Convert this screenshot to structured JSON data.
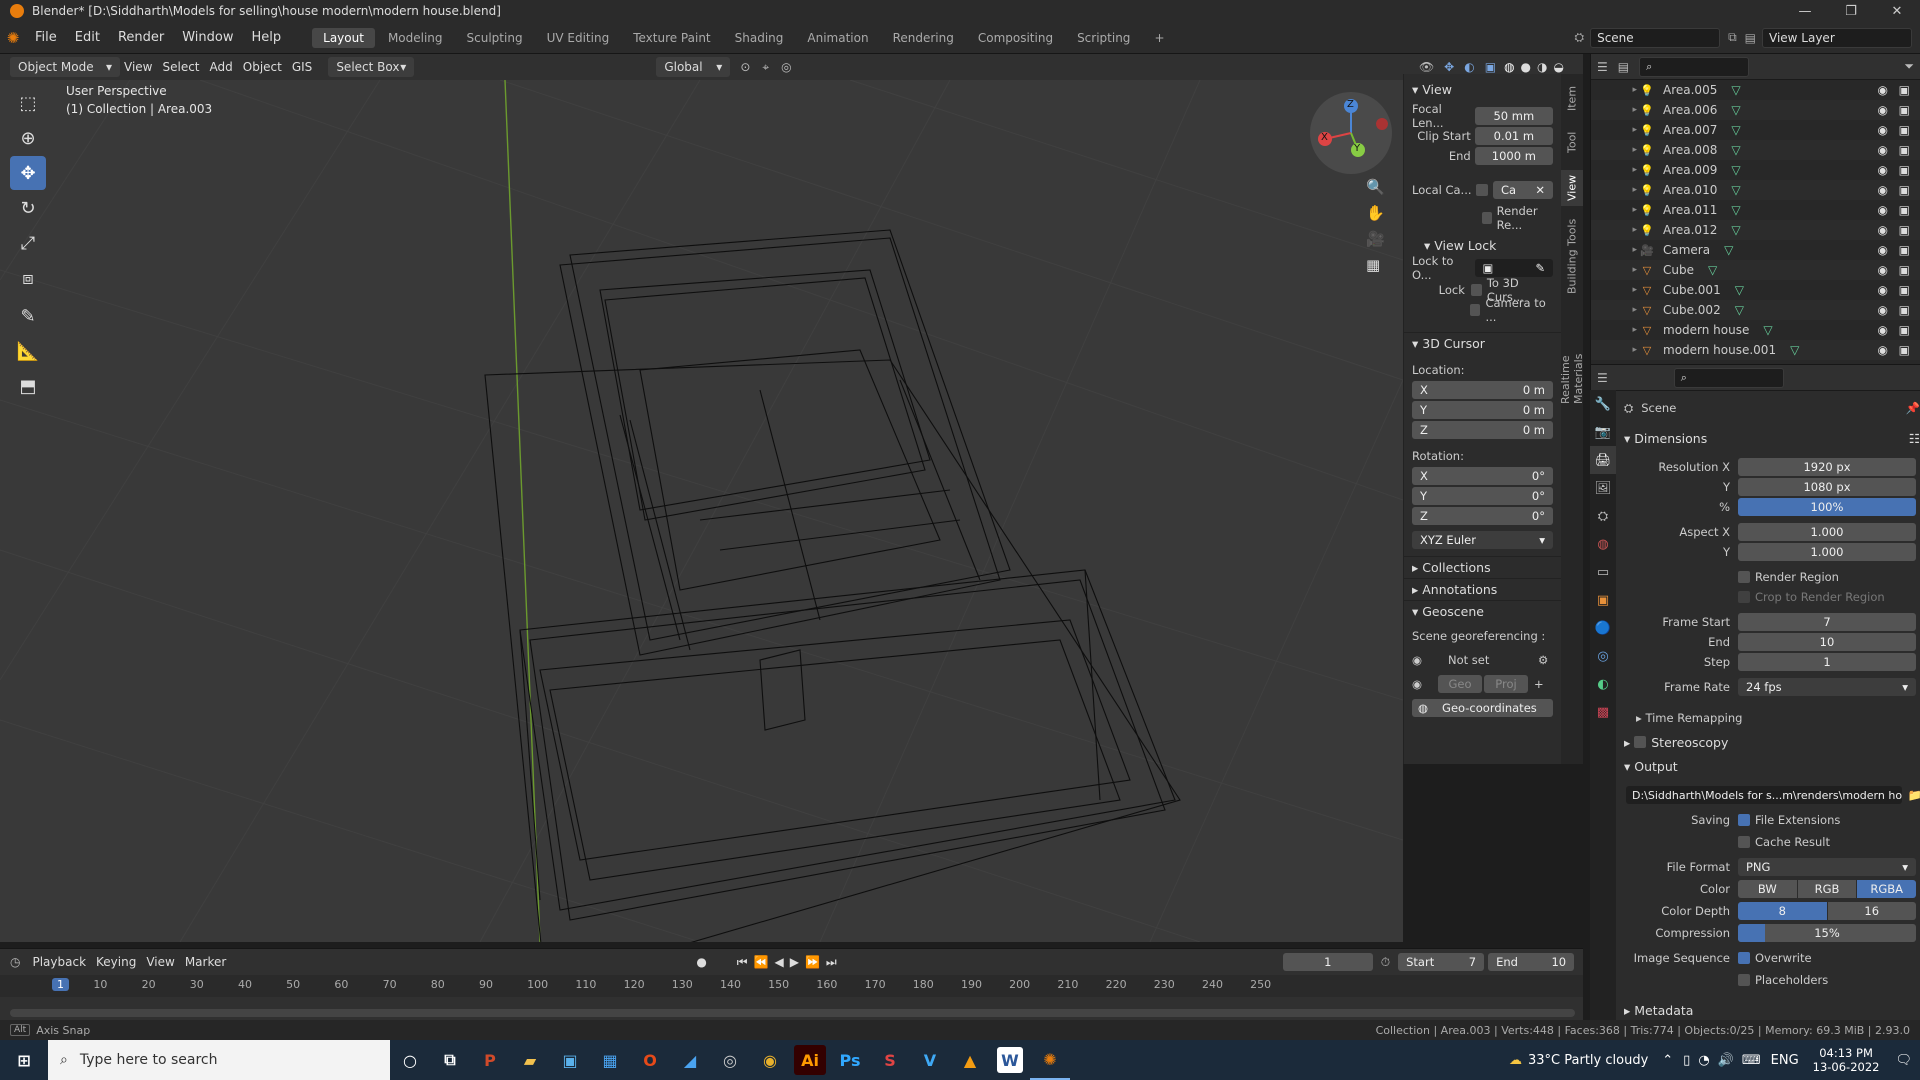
{
  "titlebar": {
    "title": "Blender* [D:\\Siddharth\\Models for selling\\house modern\\modern house.blend]"
  },
  "menubar": {
    "menus": [
      "File",
      "Edit",
      "Render",
      "Window",
      "Help"
    ],
    "workspaces": [
      "Layout",
      "Modeling",
      "Sculpting",
      "UV Editing",
      "Texture Paint",
      "Shading",
      "Animation",
      "Rendering",
      "Compositing",
      "Scripting"
    ],
    "add_tab": "+",
    "scene": "Scene",
    "view_layer": "View Layer"
  },
  "viewport_header": {
    "mode": "Object Mode",
    "menus": [
      "View",
      "Select",
      "Add",
      "Object",
      "GIS"
    ],
    "select_box": "Select Box",
    "orientation": "Global"
  },
  "viewport": {
    "perspective": "User Perspective",
    "collection": "(1) Collection | Area.003",
    "gizmo": {
      "x": "X",
      "y": "Y",
      "z": "Z"
    }
  },
  "npanel": {
    "view": {
      "title": "View",
      "focal_label": "Focal Len...",
      "focal_value": "50 mm",
      "clip_start_label": "Clip Start",
      "clip_start_value": "0.01 m",
      "end_label": "End",
      "end_value": "1000 m",
      "local_camera_label": "Local Ca...",
      "local_camera_value": "Ca",
      "render_region": "Render Re...",
      "view_lock": "View Lock",
      "lock_to_label": "Lock to O...",
      "lock_label": "Lock",
      "to_3d_cursor": "To 3D Curs...",
      "camera_to": "Camera to ..."
    },
    "cursor": {
      "title": "3D Cursor",
      "location_label": "Location:",
      "loc": [
        {
          "axis": "X",
          "value": "0 m"
        },
        {
          "axis": "Y",
          "value": "0 m"
        },
        {
          "axis": "Z",
          "value": "0 m"
        }
      ],
      "rotation_label": "Rotation:",
      "rot": [
        {
          "axis": "X",
          "value": "0°"
        },
        {
          "axis": "Y",
          "value": "0°"
        },
        {
          "axis": "Z",
          "value": "0°"
        }
      ],
      "rotation_mode": "XYZ Euler"
    },
    "collections": "Collections",
    "annotations": "Annotations",
    "geoscene": {
      "title": "Geoscene",
      "georef_label": "Scene georeferencing :",
      "not_set": "Not set",
      "geo": "Geo",
      "proj": "Proj",
      "geo_coords": "Geo-coordinates"
    },
    "tabs": [
      "Item",
      "Tool",
      "View",
      "Building Tools",
      "Realtime Materials"
    ]
  },
  "outliner": {
    "items": [
      {
        "name": "Area.005",
        "type": "light"
      },
      {
        "name": "Area.006",
        "type": "light"
      },
      {
        "name": "Area.007",
        "type": "light"
      },
      {
        "name": "Area.008",
        "type": "light"
      },
      {
        "name": "Area.009",
        "type": "light"
      },
      {
        "name": "Area.010",
        "type": "light"
      },
      {
        "name": "Area.011",
        "type": "light"
      },
      {
        "name": "Area.012",
        "type": "light"
      },
      {
        "name": "Camera",
        "type": "camera"
      },
      {
        "name": "Cube",
        "type": "mesh"
      },
      {
        "name": "Cube.001",
        "type": "mesh"
      },
      {
        "name": "Cube.002",
        "type": "mesh"
      },
      {
        "name": "modern house",
        "type": "mesh"
      },
      {
        "name": "modern house.001",
        "type": "mesh"
      }
    ]
  },
  "properties": {
    "context": "Scene",
    "dimensions": "Dimensions",
    "res_x_label": "Resolution X",
    "res_x": "1920 px",
    "res_y_label": "Y",
    "res_y": "1080 px",
    "pct_label": "%",
    "pct": "100%",
    "aspect_x_label": "Aspect X",
    "aspect_x": "1.000",
    "aspect_y_label": "Y",
    "aspect_y": "1.000",
    "render_region": "Render Region",
    "crop": "Crop to Render Region",
    "frame_start_label": "Frame Start",
    "frame_start": "7",
    "end_label": "End",
    "end": "10",
    "step_label": "Step",
    "step": "1",
    "frame_rate_label": "Frame Rate",
    "frame_rate": "24 fps",
    "time_remapping": "Time Remapping",
    "stereoscopy": "Stereoscopy",
    "output": "Output",
    "output_path": "D:\\Siddharth\\Models for s...m\\renders\\modern house",
    "saving_label": "Saving",
    "file_ext": "File Extensions",
    "cache": "Cache Result",
    "file_format_label": "File Format",
    "file_format": "PNG",
    "color_label": "Color",
    "color_opts": [
      "BW",
      "RGB",
      "RGBA"
    ],
    "depth_label": "Color Depth",
    "depth_opts": [
      "8",
      "16"
    ],
    "compression_label": "Compression",
    "compression": "15%",
    "compression_fraction": 0.15,
    "image_seq_label": "Image Sequence",
    "overwrite": "Overwrite",
    "placeholders": "Placeholders",
    "metadata": "Metadata"
  },
  "timeline": {
    "menus": [
      "Playback",
      "Keying",
      "View",
      "Marker"
    ],
    "current": "1",
    "start_label": "Start",
    "start": "7",
    "end_label": "End",
    "end": "10",
    "ticks": [
      "1",
      "10",
      "20",
      "30",
      "40",
      "50",
      "60",
      "70",
      "80",
      "90",
      "100",
      "110",
      "120",
      "130",
      "140",
      "150",
      "160",
      "170",
      "180",
      "190",
      "200",
      "210",
      "220",
      "230",
      "240",
      "250"
    ]
  },
  "status": {
    "left": "Axis Snap",
    "right": "Collection | Area.003 | Verts:448 | Faces:368 | Tris:774 | Objects:0/25 | Memory: 69.3 MiB | 2.93.0"
  },
  "taskbar": {
    "search": "Type here to search",
    "weather": "33°C  Partly cloudy",
    "lang": "ENG",
    "time": "04:13 PM",
    "date": "13-06-2022"
  },
  "colors": {
    "accent": "#4772b3",
    "blender_orange": "#e87d0d"
  }
}
